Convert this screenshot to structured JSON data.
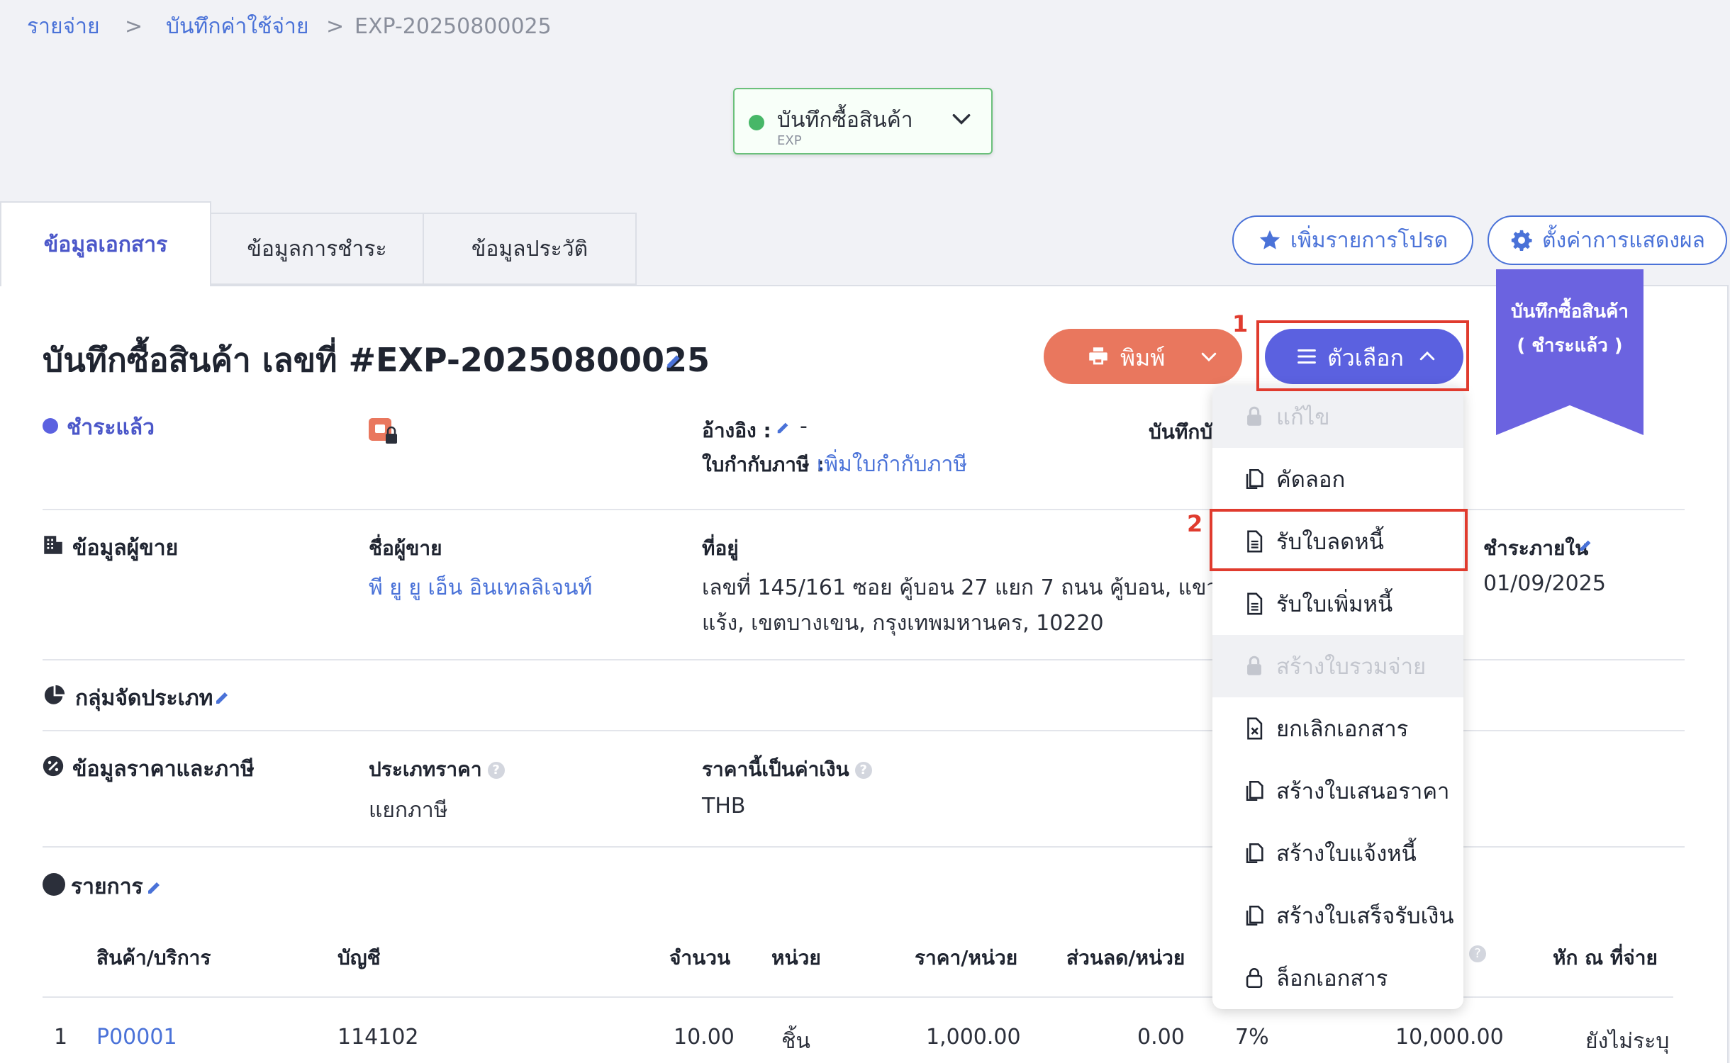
{
  "breadcrumb": {
    "items": [
      "รายจ่าย",
      "บันทึกค่าใช้จ่าย",
      "EXP-20250800025"
    ],
    "separator": ">"
  },
  "doc_type": {
    "label": "บันทึกซื้อสินค้า",
    "code": "EXP",
    "status_color": "#47b768"
  },
  "tabs": [
    "ข้อมูลเอกสาร",
    "ข้อมูลการชำระ",
    "ข้อมูลประวัติ"
  ],
  "top_actions": {
    "favorite": "เพิ่มรายการโปรด",
    "display_settings": "ตั้งค่าการแสดงผล"
  },
  "ribbon": {
    "line1": "บันทึกซื้อสินค้า",
    "line2": "( ชำระแล้ว )"
  },
  "document": {
    "title": "บันทึกซื้อสินค้า เลขที่ #EXP-20250800025",
    "status": "ชำระแล้ว",
    "reference_label": "อ้างอิง :",
    "reference_value": "-",
    "tax_invoice_label": "ใบกำกับภาษี :",
    "tax_invoice_link": "เพิ่มใบกำกับภาษี",
    "record_label_partial": "บันทึกบั"
  },
  "buttons": {
    "print": "พิมพ์",
    "options": "ตัวเลือก"
  },
  "annotations": {
    "n1": "1",
    "n2": "2"
  },
  "options_menu": [
    {
      "label": "แก้ไข",
      "icon": "lock-icon",
      "disabled": true
    },
    {
      "label": "คัดลอก",
      "icon": "copy-icon",
      "disabled": false
    },
    {
      "label": "รับใบลดหนี้",
      "icon": "document-icon",
      "disabled": false
    },
    {
      "label": "รับใบเพิ่มหนี้",
      "icon": "document-icon",
      "disabled": false
    },
    {
      "label": "สร้างใบรวมจ่าย",
      "icon": "lock-icon",
      "disabled": true
    },
    {
      "label": "ยกเลิกเอกสาร",
      "icon": "cancel-document-icon",
      "disabled": false
    },
    {
      "label": "สร้างใบเสนอราคา",
      "icon": "copy-icon",
      "disabled": false
    },
    {
      "label": "สร้างใบแจ้งหนี้",
      "icon": "copy-icon",
      "disabled": false
    },
    {
      "label": "สร้างใบเสร็จรับเงิน",
      "icon": "copy-icon",
      "disabled": false
    },
    {
      "label": "ล็อกเอกสาร",
      "icon": "lock-outline-icon",
      "disabled": false
    }
  ],
  "vendor": {
    "section_title": "ข้อมูลผู้ขาย",
    "name_label": "ชื่อผู้ขาย",
    "name_value": "พี ยู ยู เอ็น อินเทลลิเจนท์",
    "address_label": "ที่อยู่",
    "address_line1": "เลขที่ 145/161 ซอย คู้บอน 27 แยก 7 ถนน คู้บอน, แขวงท่",
    "address_line2": "แร้ง, เขตบางเขน, กรุงเทพมหานคร, 10220",
    "due_label": "ชำระภายใน",
    "due_value": "01/09/2025"
  },
  "category": {
    "section_title": "กลุ่มจัดประเภท"
  },
  "pricing": {
    "section_title": "ข้อมูลราคาและภาษี",
    "price_type_label": "ประเภทราคา",
    "price_type_value": "แยกภาษี",
    "currency_label": "ราคานี้เป็นค่าเงิน",
    "currency_value": "THB"
  },
  "items": {
    "section_title": "รายการ",
    "columns": [
      "สินค้า/บริการ",
      "บัญชี",
      "จำนวน",
      "หน่วย",
      "ราคา/หน่วย",
      "ส่วนลด/หน่วย",
      "หัก ณ ที่จ่าย"
    ],
    "rows": [
      {
        "no": "1",
        "product": "P00001",
        "account": "114102",
        "qty": "10.00",
        "unit": "ชิ้น",
        "price": "1,000.00",
        "discount": "0.00",
        "vat": "7%",
        "amount": "10,000.00",
        "wht": "ยังไม่ระบุ"
      }
    ]
  },
  "colors": {
    "accent": "#4a72d8",
    "primary": "#5b61e0",
    "print": "#e9775e",
    "annotation": "#e03b2e"
  }
}
